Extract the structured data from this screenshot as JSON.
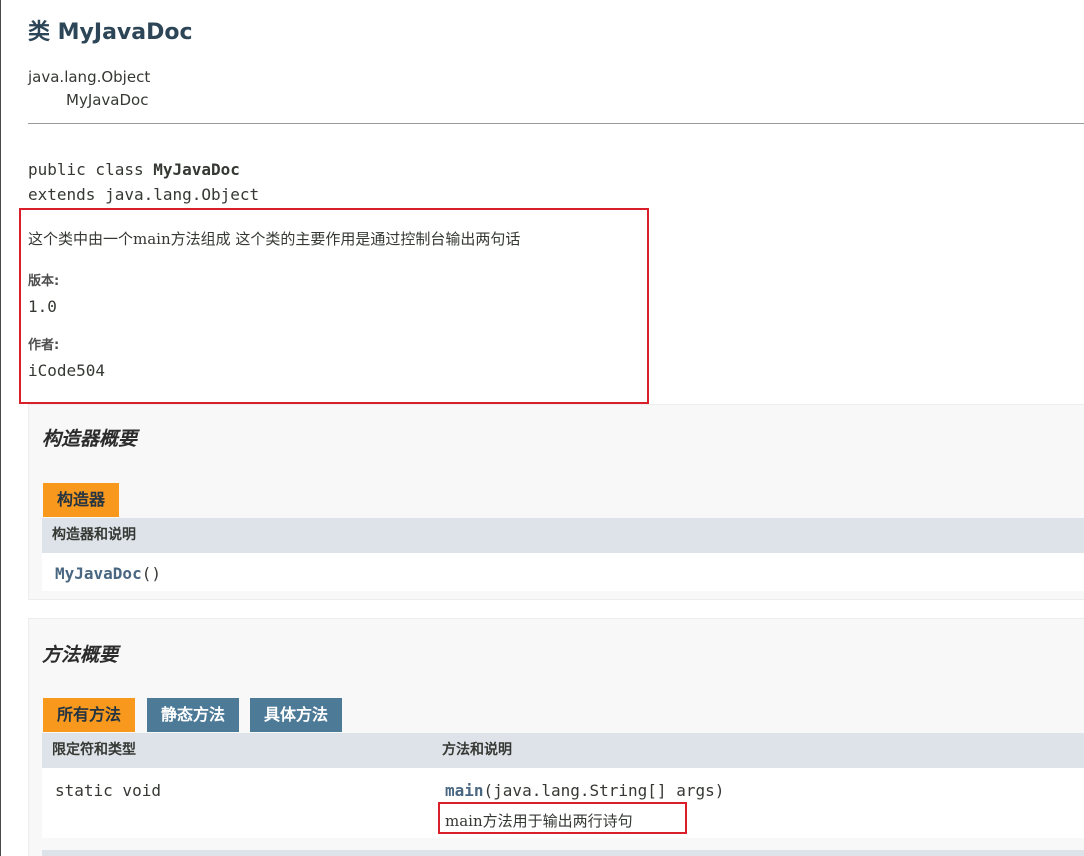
{
  "header": {
    "title": "类 MyJavaDoc"
  },
  "inheritance": {
    "parent": "java.lang.Object",
    "child": "MyJavaDoc"
  },
  "signature": {
    "line1_prefix": "public class ",
    "line1_name": "MyJavaDoc",
    "line2": "extends java.lang.Object"
  },
  "doc": {
    "description": "这个类中由一个main方法组成 这个类的主要作用是通过控制台输出两句话",
    "version_label": "版本:",
    "version_value": "1.0",
    "author_label": "作者:",
    "author_value": "iCode504"
  },
  "constructor_summary": {
    "title": "构造器概要",
    "tab_label": "构造器",
    "column_header": "构造器和说明",
    "rows": [
      {
        "name": "MyJavaDoc",
        "params": "()"
      }
    ]
  },
  "method_summary": {
    "title": "方法概要",
    "tabs": [
      {
        "label": "所有方法",
        "active": true
      },
      {
        "label": "静态方法",
        "active": false
      },
      {
        "label": "具体方法",
        "active": false
      }
    ],
    "columns": [
      "限定符和类型",
      "方法和说明"
    ],
    "rows": [
      {
        "modifier": "static void",
        "name": "main",
        "params": "(java.lang.String[] args)",
        "description": "main方法用于输出两行诗句"
      }
    ]
  },
  "colors": {
    "accent_orange": "#f8981d",
    "tab_blue": "#4d7a97",
    "highlight_red": "#d9202a",
    "link": "#4a6782"
  }
}
